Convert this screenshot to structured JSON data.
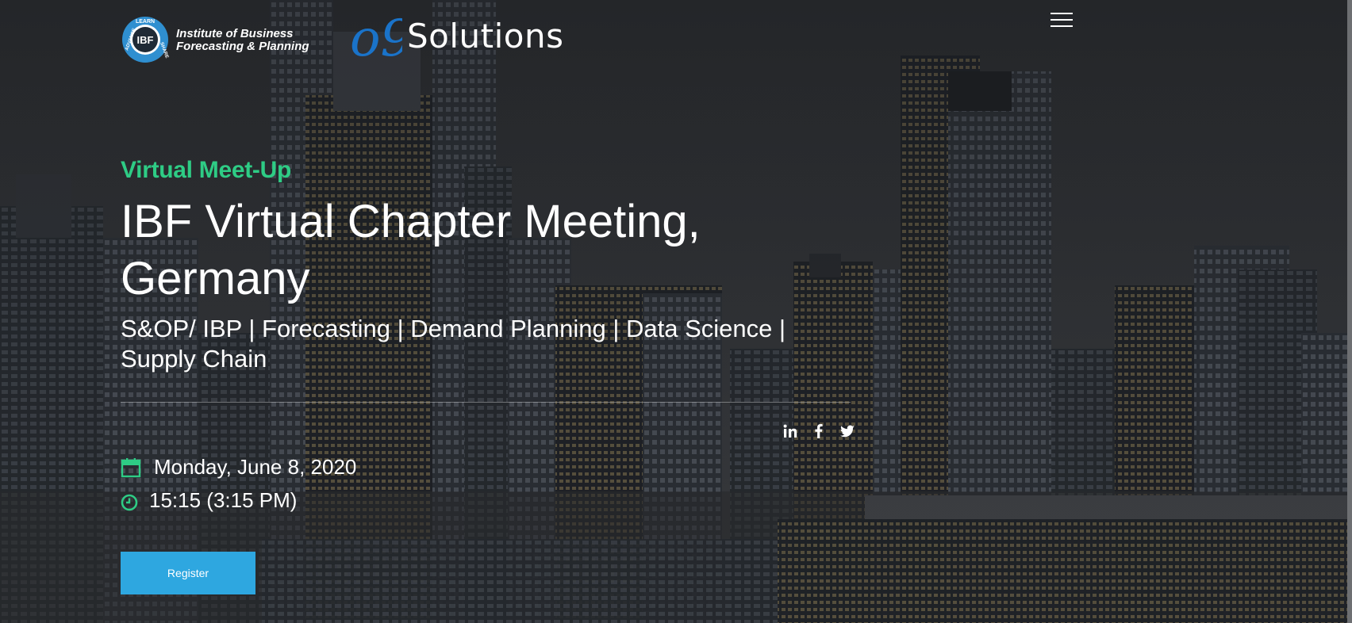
{
  "header": {
    "ibf_logo": {
      "badge_text": "IBF",
      "ring_top": "LEARN",
      "ring_left": "ADVANCE",
      "ring_right": "SHARE",
      "line1": "Institute of Business",
      "line2": "Forecasting & Planning"
    },
    "partner_logo": {
      "mark": "o9",
      "word": "Solutions"
    },
    "menu_icon": "hamburger-menu-icon"
  },
  "event": {
    "eyebrow": "Virtual Meet-Up",
    "title": "IBF Virtual Chapter Meeting, Germany",
    "subtitle": "S&OP/ IBP | Forecasting | Demand Planning | Data Science | Supply Chain",
    "date": "Monday, June 8, 2020",
    "time": "15:15 (3:15 PM)",
    "register_label": "Register"
  },
  "social": [
    "linkedin-icon",
    "facebook-icon",
    "twitter-icon"
  ],
  "colors": {
    "accent_green": "#2ecc85",
    "button_blue": "#2ea7e0",
    "ibf_blue": "#2f8fd0",
    "o9_blue": "#1a73c9"
  }
}
